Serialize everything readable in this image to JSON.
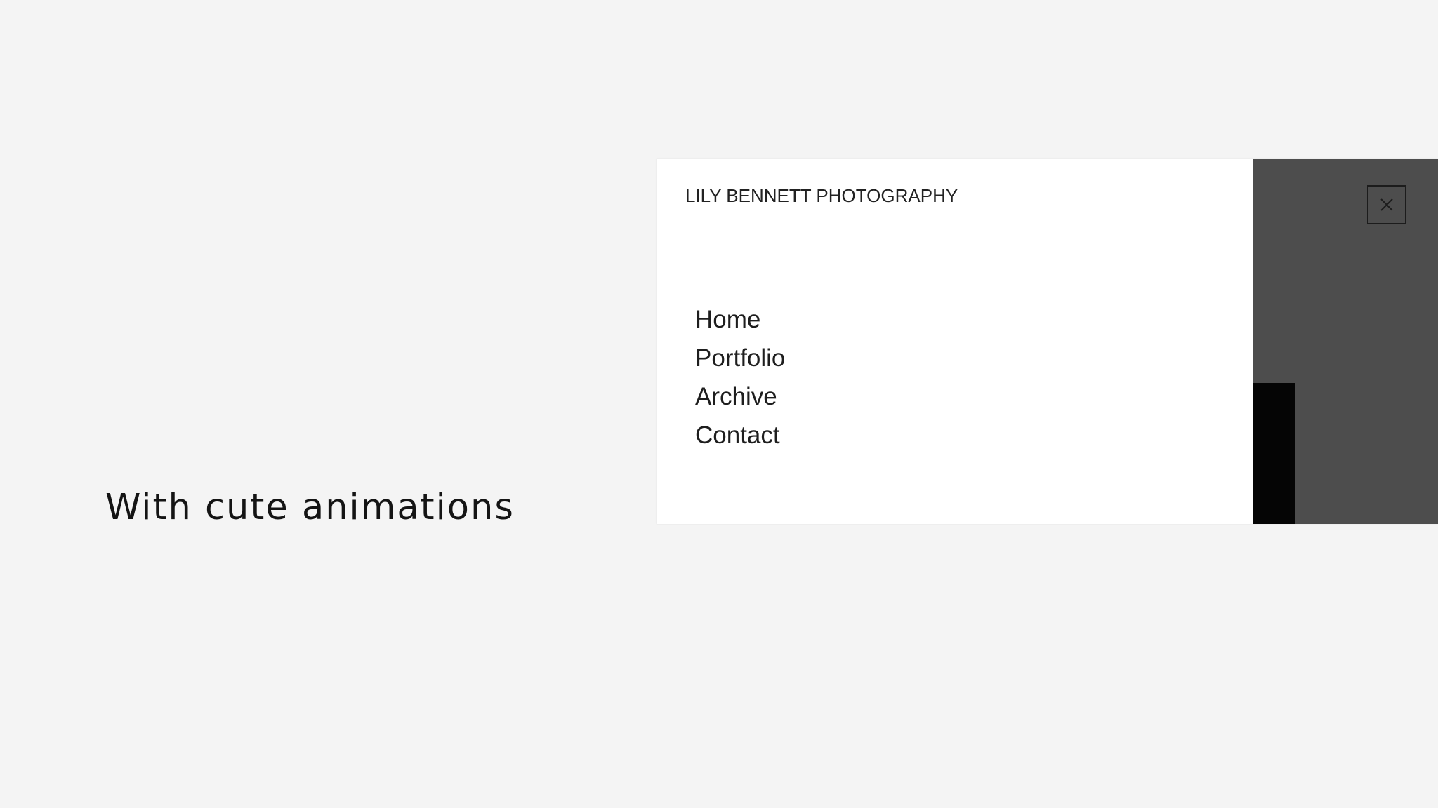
{
  "caption": "With cute animations",
  "site": {
    "brand": "LILY BENNETT PHOTOGRAPHY",
    "nav_items": [
      "Home",
      "Portfolio",
      "Archive",
      "Contact"
    ],
    "close_icon": "close-icon"
  },
  "colors": {
    "background": "#f4f4f4",
    "menu_panel": "#ffffff",
    "overlay": "#4d4d4d",
    "overlay_block": "#050505",
    "text": "#1e1e1e"
  }
}
